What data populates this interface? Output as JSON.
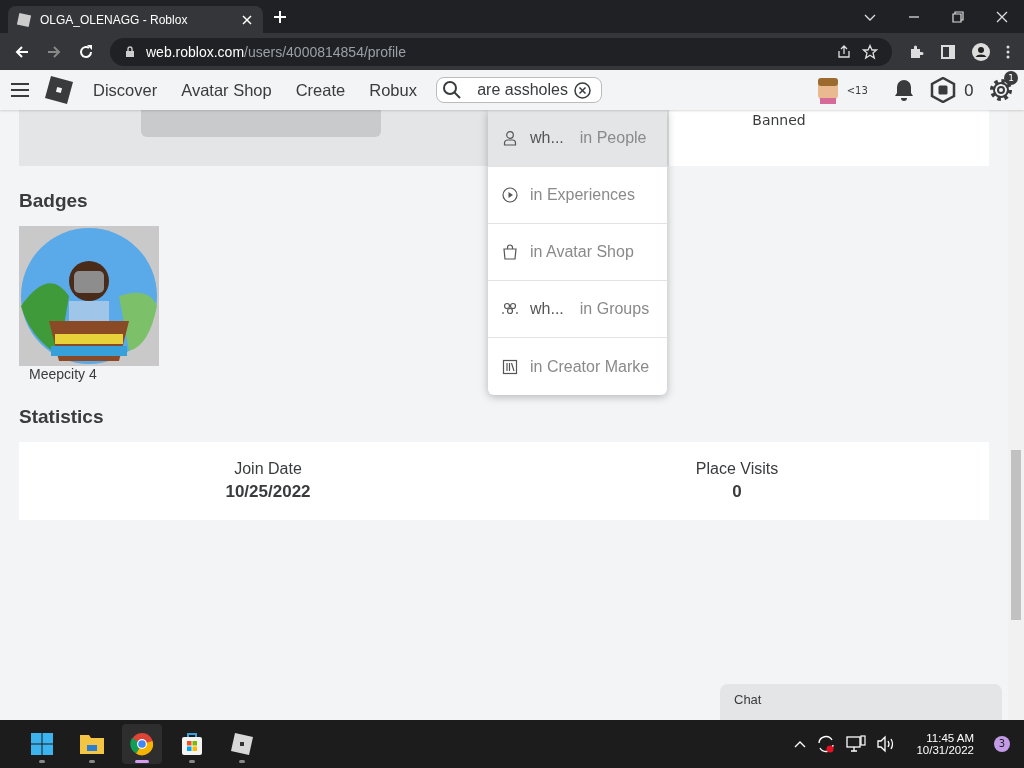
{
  "browser": {
    "tab_title": "OLGA_OLENAGG - Roblox",
    "url_host": "web.roblox.com",
    "url_path": "/users/4000814854/profile"
  },
  "nav": {
    "links": [
      "Discover",
      "Avatar Shop",
      "Create",
      "Robux"
    ],
    "search_value": "are assholes",
    "age_label": "<13",
    "robux": "0",
    "settings_badge": "1"
  },
  "search_menu": [
    {
      "kind": "people",
      "query": "wh...",
      "scope": "in People",
      "selected": true
    },
    {
      "kind": "experiences",
      "scope": "in Experiences",
      "selected": false
    },
    {
      "kind": "shop",
      "scope": "in Avatar Shop",
      "selected": false
    },
    {
      "kind": "groups",
      "query": "wh...",
      "scope": "in Groups",
      "selected": false
    },
    {
      "kind": "creator",
      "scope": "in Creator Marke",
      "selected": false
    }
  ],
  "profile_status": "Banned",
  "badges": {
    "title": "Badges",
    "items": [
      {
        "kind": "picture",
        "name": "Meepcity 4"
      }
    ]
  },
  "statistics": {
    "title": "Statistics",
    "items": [
      {
        "label": "Join Date",
        "value": "10/25/2022"
      },
      {
        "label": "Place Visits",
        "value": "0"
      }
    ]
  },
  "chat": {
    "label": "Chat"
  },
  "taskbar": {
    "apps": [
      {
        "kind": "start",
        "selected": false
      },
      {
        "kind": "files",
        "selected": false
      },
      {
        "kind": "chrome",
        "selected": true
      },
      {
        "kind": "store",
        "selected": false
      },
      {
        "kind": "roblox",
        "selected": false
      }
    ],
    "time": "11:45 AM",
    "date": "10/31/2022",
    "notifications": "3"
  }
}
